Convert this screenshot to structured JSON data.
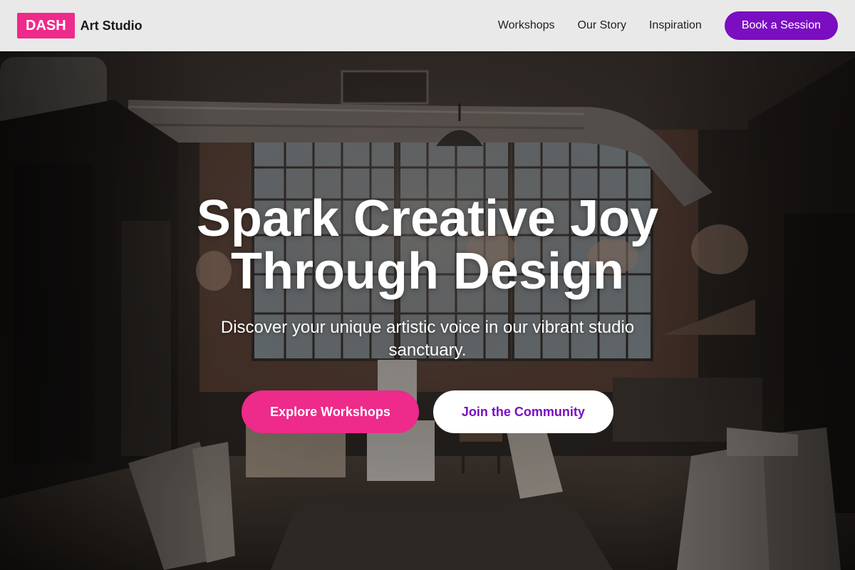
{
  "header": {
    "logo": "DASH",
    "brand": "Art Studio",
    "nav": [
      {
        "label": "Workshops"
      },
      {
        "label": "Our Story"
      },
      {
        "label": "Inspiration"
      }
    ],
    "cta": "Book a Session"
  },
  "hero": {
    "title_line1": "Spark Creative Joy",
    "title_line2": "Through Design",
    "subtitle": "Discover your unique artistic voice in our vibrant studio sanctuary.",
    "primary_button": "Explore Workshops",
    "secondary_button": "Join the Community"
  },
  "colors": {
    "brand_pink": "#ee2a8a",
    "brand_purple": "#7a0ec0",
    "header_bg": "#e9e9e9"
  }
}
